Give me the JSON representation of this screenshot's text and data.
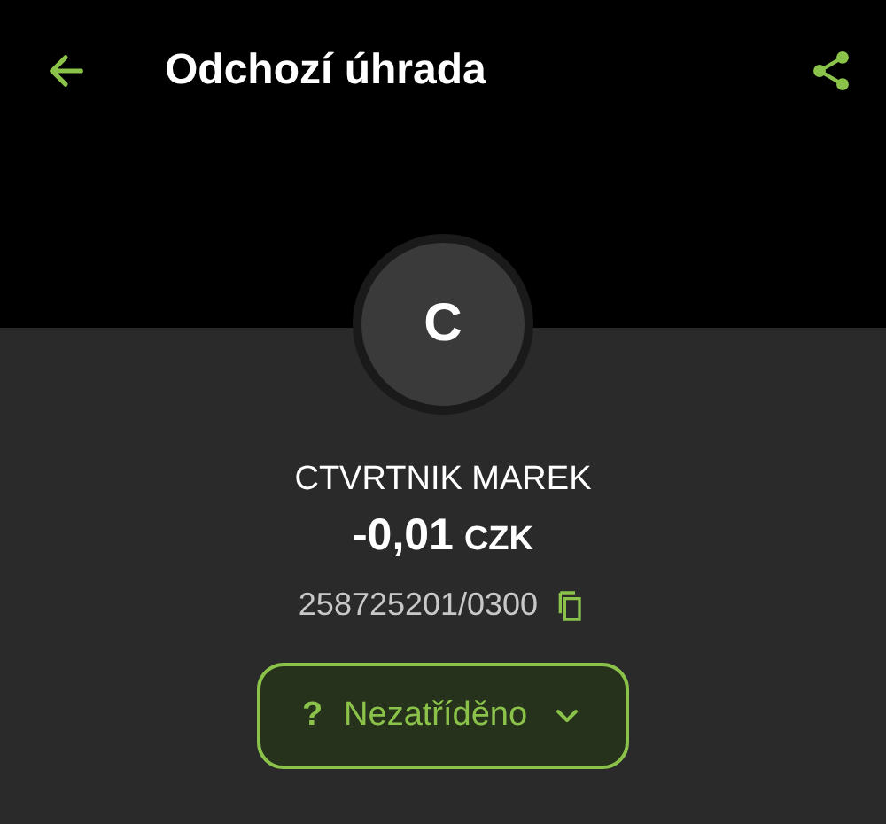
{
  "top_bar": {
    "title": "Odchozí úhrada"
  },
  "counterparty": {
    "avatar_letter": "C",
    "name": "CTVRTNIK MAREK",
    "amount": "-0,01",
    "currency": "CZK",
    "account": "258725201/0300"
  },
  "category_button": {
    "symbol": "?",
    "label": "Nezatříděno"
  }
}
